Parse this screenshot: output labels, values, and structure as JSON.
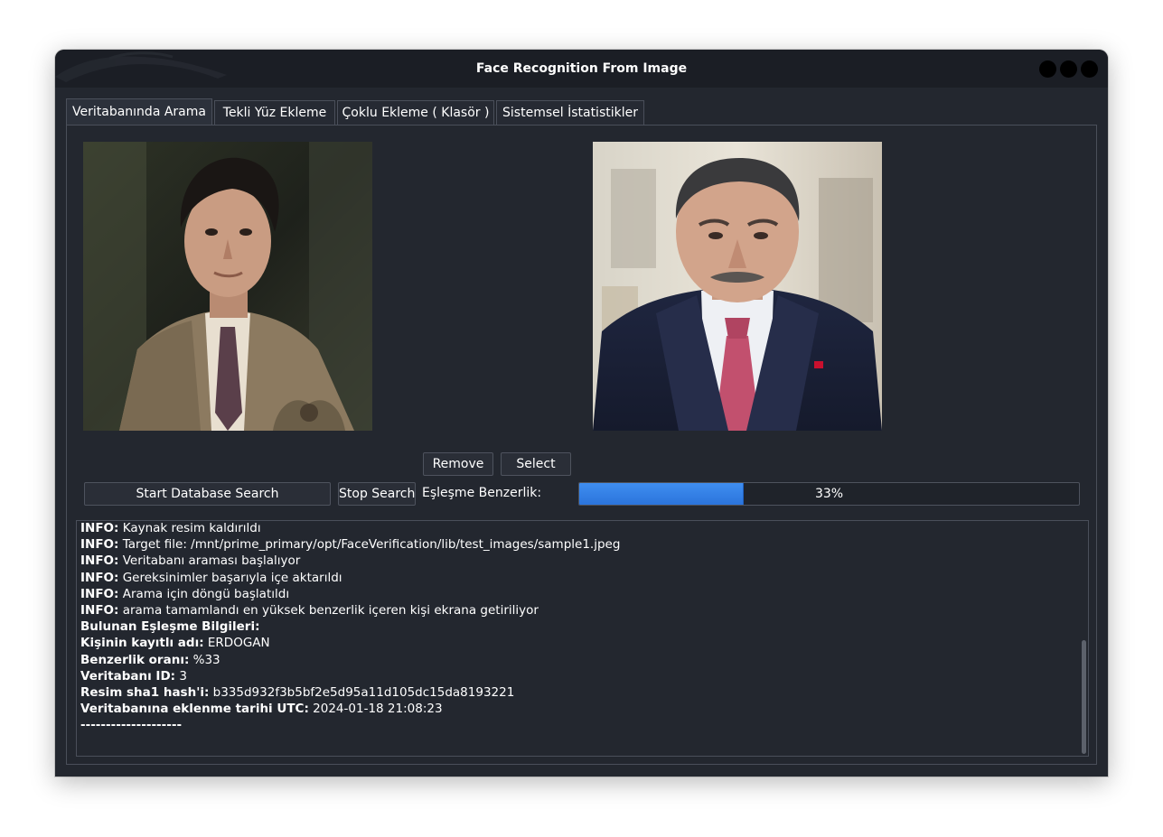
{
  "window": {
    "title": "Face Recognition From Image",
    "controls": [
      "circle",
      "circle",
      "circle"
    ]
  },
  "tabs": [
    {
      "label": "Veritabanında Arama",
      "active": true
    },
    {
      "label": "Tekli Yüz Ekleme",
      "active": false
    },
    {
      "label": "Çoklu Ekleme ( Klasör )",
      "active": false
    },
    {
      "label": "Sistemsel İstatistikler",
      "active": false
    }
  ],
  "images": {
    "source_description_icon": "portrait-photo",
    "match_description_icon": "portrait-photo"
  },
  "buttons": {
    "remove": "Remove",
    "select": "Select",
    "start_search": "Start Database Search",
    "stop_search": "Stop Search"
  },
  "similarity": {
    "label": "Eşleşme Benzerlik:",
    "value": 0.33,
    "text": "33%"
  },
  "log": [
    {
      "key": "INFO:",
      "text": " Kaynak resim kaldırıldı"
    },
    {
      "key": "INFO:",
      "text": " Target file: /mnt/prime_primary/opt/FaceVerification/lib/test_images/sample1.jpeg"
    },
    {
      "key": "INFO:",
      "text": " Veritabanı araması başlalıyor"
    },
    {
      "key": "INFO:",
      "text": " Gereksinimler başarıyla içe aktarıldı"
    },
    {
      "key": "INFO:",
      "text": " Arama için döngü başlatıldı"
    },
    {
      "key": "INFO:",
      "text": " arama tamamlandı en yüksek benzerlik içeren kişi ekrana getiriliyor"
    },
    {
      "key": "Bulunan Eşleşme Bilgileri:",
      "text": ""
    },
    {
      "key": "Kişinin kayıtlı adı:",
      "text": " ERDOGAN"
    },
    {
      "key": "Benzerlik oranı:",
      "text": " %33"
    },
    {
      "key": "Veritabanı ID:",
      "text": " 3"
    },
    {
      "key": "Resim sha1 hash'i:",
      "text": " b335d932f3b5bf2e5d95a11d105dc15da8193221"
    },
    {
      "key": "Veritabanına eklenme tarihi UTC:",
      "text": " 2024-01-18 21:08:23"
    },
    {
      "key": "--------------------",
      "text": ""
    }
  ],
  "colors": {
    "window_bg": "#23272f",
    "titlebar_bg": "#1b1e25",
    "accent": "#2b74dc"
  }
}
